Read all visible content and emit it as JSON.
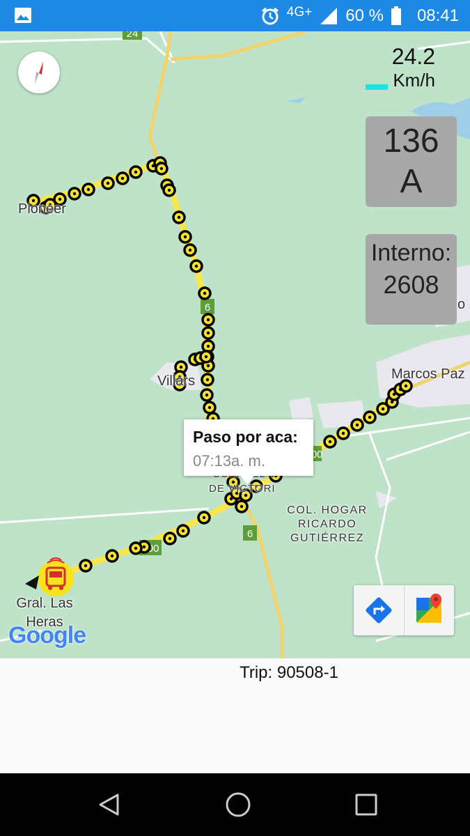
{
  "status_bar": {
    "network": "4G+",
    "battery": "60 %",
    "time": "08:41",
    "icons": [
      "image-icon",
      "alarm-icon",
      "signal-icon",
      "battery-icon"
    ]
  },
  "map": {
    "route_shields": [
      "24",
      "6",
      "6",
      "6",
      "200",
      "200"
    ],
    "place_labels": {
      "pioneer": "Pioneer",
      "villars": "Villars",
      "marcos_paz": "Marcos Paz",
      "mariano_acosta_partial": "o",
      "cuartel": "CUARTEL V",
      "de_victoria": "DE VICTORI",
      "col_hogar_1": "COL. HOGAR",
      "col_hogar_2": "RICARDO",
      "col_hogar_3": "GUTIÉRREZ",
      "gral_1": "Gral. Las",
      "gral_2": "Heras"
    },
    "attribution": "Google",
    "colors": {
      "map_bg": "#bfe3c9",
      "route": "#f9e64f",
      "marker_ring": "#000000",
      "marker_fill": "#f5e22c"
    }
  },
  "overlay": {
    "speed_value": "24.2",
    "speed_unit": "Km/h",
    "line_number": "136",
    "line_letter": "A",
    "interno_label": "Interno:",
    "interno_value": "2608"
  },
  "info_window": {
    "title": "Paso por aca:",
    "subtitle": "07:13a. m."
  },
  "map_buttons": [
    "directions-icon",
    "google-maps-icon"
  ],
  "trip": "Trip: 90508-1",
  "nav_bar": [
    "back-icon",
    "home-icon",
    "recents-icon"
  ]
}
